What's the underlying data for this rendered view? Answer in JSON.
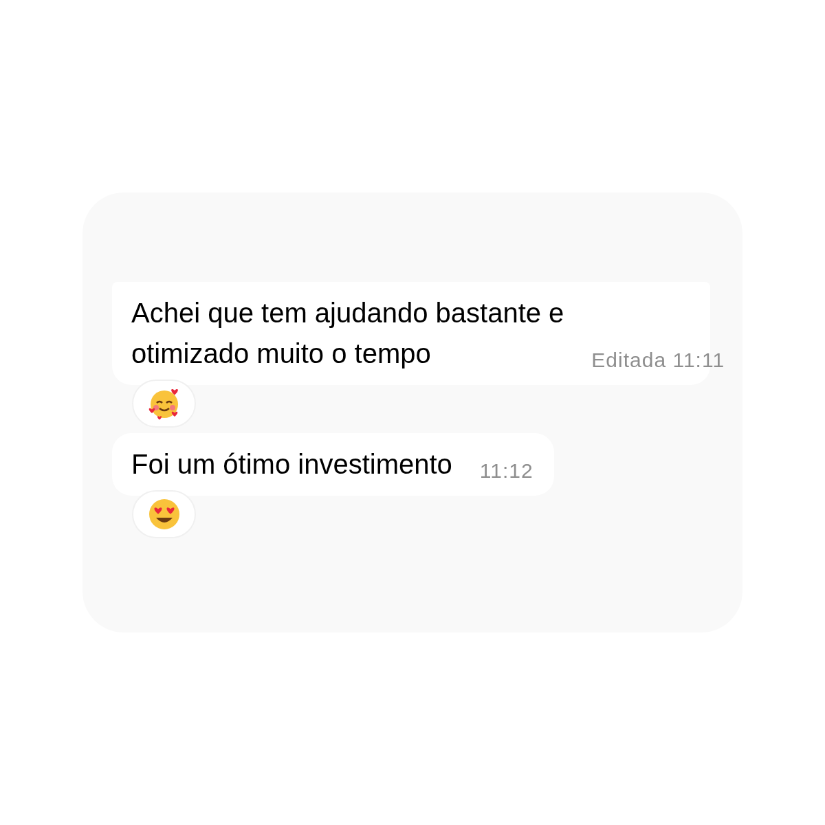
{
  "messages": [
    {
      "lines": [
        "Achei que tem ajudando bastante e",
        "otimizado muito o tempo"
      ],
      "meta": "Editada 11:11",
      "reaction": {
        "kind": "hearts"
      }
    },
    {
      "lines": [
        "Foi um ótimo investimento"
      ],
      "meta": "11:12",
      "reaction": {
        "kind": "heart_eyes"
      }
    }
  ]
}
